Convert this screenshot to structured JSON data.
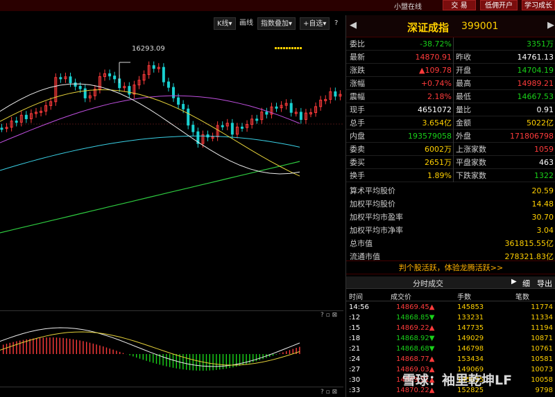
{
  "topbar": {
    "username": "小盟在线",
    "buttons": [
      "交 易",
      "低佣开户",
      "学习成长"
    ]
  },
  "chart_toolbar": {
    "kline": "K线▾",
    "draw": "画线",
    "index_overlay": "指数叠加▾",
    "custom": "+自选▾",
    "help": "?"
  },
  "chart": {
    "high_label": "16293.09",
    "macd_help": "? ▫ ⊠",
    "bottom_help": "? ▫ ⊠"
  },
  "quote": {
    "name": "深证成指",
    "code": "399001",
    "rows": [
      {
        "l1": "委比",
        "v1": "-38.72%",
        "c1": "green",
        "l2": "",
        "v2": "3351万",
        "c2": "green"
      },
      {
        "l1": "最新",
        "v1": "14870.91",
        "c1": "red",
        "l2": "昨收",
        "v2": "14761.13",
        "c2": "white"
      },
      {
        "l1": "涨跌",
        "v1": "▲109.78",
        "c1": "red",
        "l2": "开盘",
        "v2": "14704.19",
        "c2": "green"
      },
      {
        "l1": "涨幅",
        "v1": "+0.74%",
        "c1": "red",
        "l2": "最高",
        "v2": "14989.21",
        "c2": "red"
      },
      {
        "l1": "震幅",
        "v1": "2.18%",
        "c1": "red",
        "l2": "最低",
        "v2": "14667.53",
        "c2": "green"
      },
      {
        "l1": "现手",
        "v1": "4651072",
        "c1": "white",
        "l2": "量比",
        "v2": "0.91",
        "c2": "white"
      },
      {
        "l1": "总手",
        "v1": "3.654亿",
        "c1": "yellow",
        "l2": "金额",
        "v2": "5022亿",
        "c2": "yellow"
      },
      {
        "l1": "内盘",
        "v1": "193579058",
        "c1": "green",
        "l2": "外盘",
        "v2": "171806798",
        "c2": "red"
      },
      {
        "l1": "委卖",
        "v1": "6002万",
        "c1": "yellow",
        "l2": "上涨家数",
        "v2": "1059",
        "c2": "red"
      },
      {
        "l1": "委买",
        "v1": "2651万",
        "c1": "yellow",
        "l2": "平盘家数",
        "v2": "463",
        "c2": "white"
      },
      {
        "l1": "换手",
        "v1": "1.89%",
        "c1": "yellow",
        "l2": "下跌家数",
        "v2": "1322",
        "c2": "green"
      }
    ],
    "stats": [
      {
        "label": "算术平均股价",
        "value": "20.59"
      },
      {
        "label": "加权平均股价",
        "value": "14.48"
      },
      {
        "label": "加权平均市盈率",
        "value": "30.70"
      },
      {
        "label": "加权平均市净率",
        "value": "3.04"
      },
      {
        "label": "总市值",
        "value": "361815.55亿"
      },
      {
        "label": "流通市值",
        "value": "278321.83亿"
      }
    ],
    "promo": "判个股活跃，体验龙腾活跃>>"
  },
  "ticks": {
    "title": "分时成交",
    "detail": "细",
    "export": "导出",
    "columns": [
      "时间",
      "成交价",
      "手数",
      "笔数"
    ],
    "rows": [
      {
        "t": "14:56",
        "p": "14869.45▲",
        "pc": "red",
        "v": "145853",
        "n": "11774"
      },
      {
        "t": ":12",
        "p": "14868.85▼",
        "pc": "green",
        "v": "133231",
        "n": "11334"
      },
      {
        "t": ":15",
        "p": "14869.22▲",
        "pc": "red",
        "v": "147735",
        "n": "11194"
      },
      {
        "t": ":18",
        "p": "14868.92▼",
        "pc": "green",
        "v": "149029",
        "n": "10871"
      },
      {
        "t": ":21",
        "p": "14868.68▼",
        "pc": "green",
        "v": "146798",
        "n": "10761"
      },
      {
        "t": ":24",
        "p": "14868.77▲",
        "pc": "red",
        "v": "153434",
        "n": "10581"
      },
      {
        "t": ":27",
        "p": "14869.03▲",
        "pc": "red",
        "v": "149069",
        "n": "10073"
      },
      {
        "t": ":30",
        "p": "14869.91▲",
        "pc": "red",
        "v": "145625",
        "n": "10058"
      },
      {
        "t": ":33",
        "p": "14870.22▲",
        "pc": "red",
        "v": "152825",
        "n": "9798"
      }
    ]
  },
  "watermark": "雪球：袖里乾坤LF",
  "colors": {
    "up": "#ff3b3b",
    "down": "#19d119",
    "accent": "#ffd000"
  }
}
